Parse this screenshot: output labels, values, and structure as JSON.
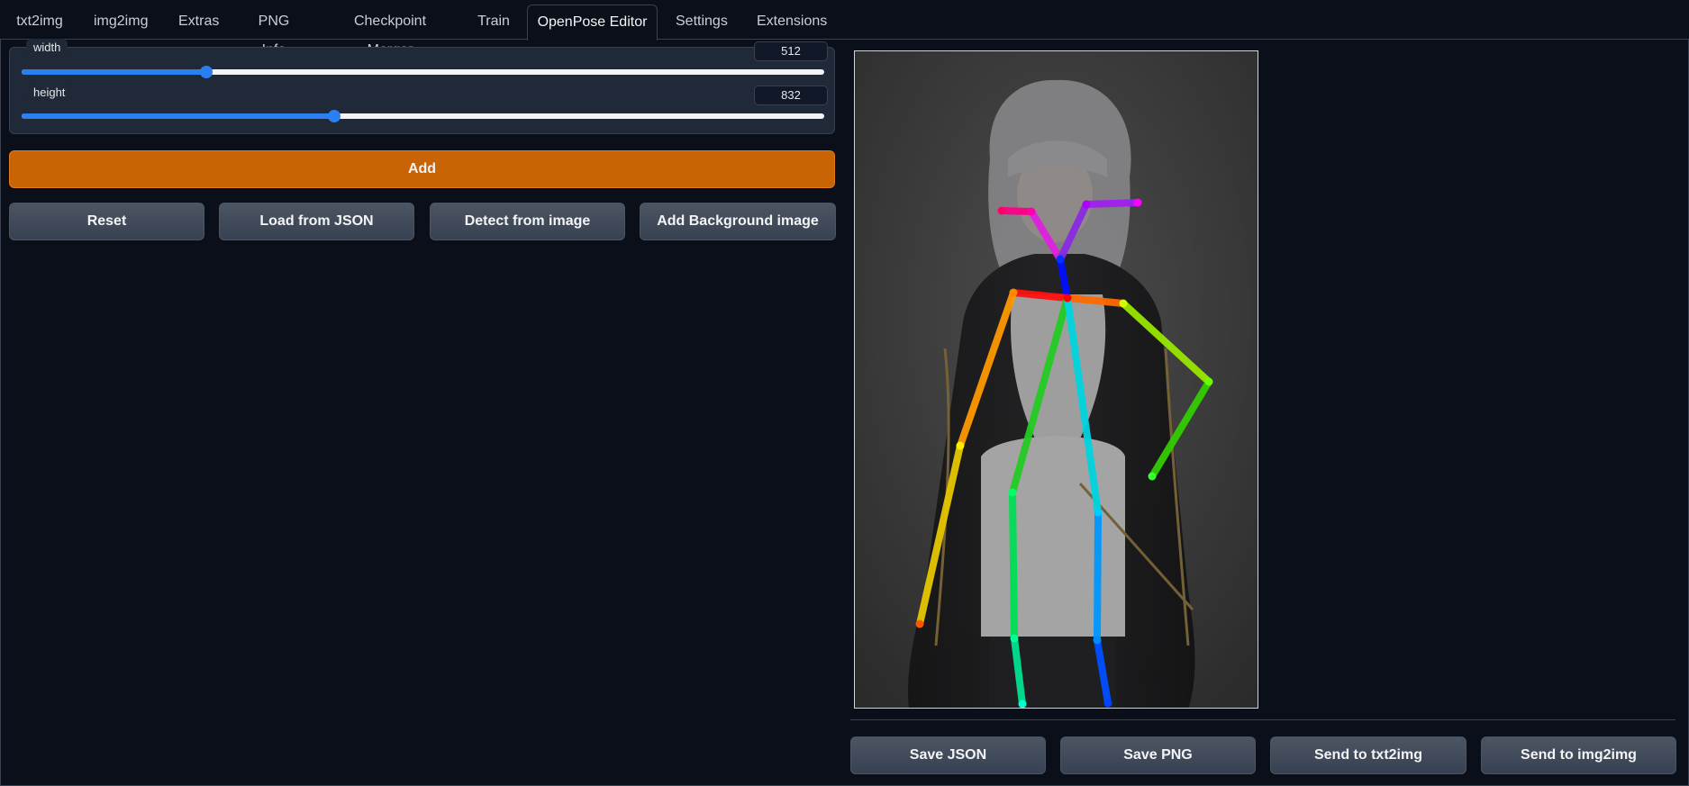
{
  "tabs": [
    "txt2img",
    "img2img",
    "Extras",
    "PNG Info",
    "Checkpoint Merger",
    "Train",
    "OpenPose Editor",
    "Settings",
    "Extensions"
  ],
  "active_tab": "OpenPose Editor",
  "sliders": {
    "width": {
      "label": "width",
      "value": "512",
      "fraction": 0.23
    },
    "height": {
      "label": "height",
      "value": "832",
      "fraction": 0.39
    }
  },
  "buttons": {
    "add": "Add",
    "reset": "Reset",
    "load_json": "Load from JSON",
    "detect": "Detect from image",
    "add_background": "Add Background image",
    "save_json": "Save JSON",
    "save_png": "Save PNG",
    "send_txt2img": "Send to txt2img",
    "send_img2img": "Send to img2img"
  },
  "colors": {
    "accent": "#c86405",
    "slider": "#2b7ff0",
    "background": "#0b0f19"
  }
}
